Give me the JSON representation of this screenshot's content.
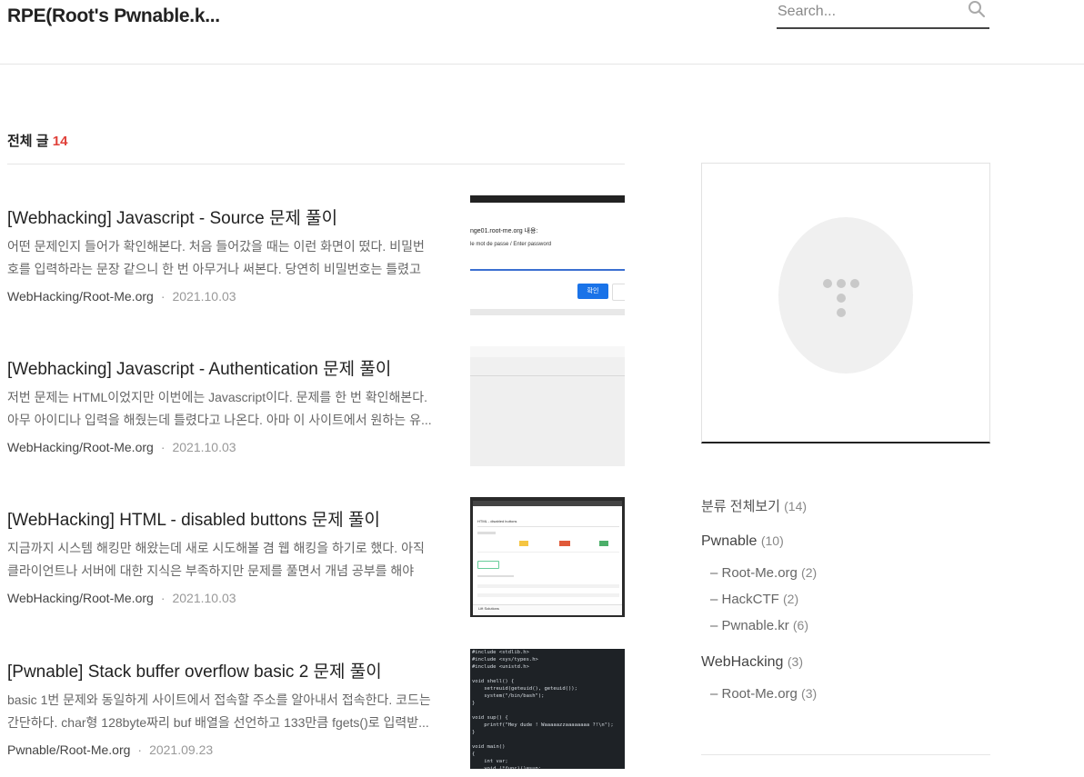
{
  "header": {
    "site_title": "RPE(Root's Pwnable.k...",
    "search_placeholder": "Search..."
  },
  "listing": {
    "label": "전체 글",
    "count": "14"
  },
  "posts": [
    {
      "title": "[Webhacking] Javascript - Source 문제 풀이",
      "excerpt": "어떤 문제인지 들어가 확인해본다. 처음 들어갔을 때는 이런 화면이 떴다. 비밀번호를 입력하라는 문장 같으니 한 번 아무거나 써본다. 당연히 비밀번호는 틀렸고 개...",
      "category": "WebHacking/Root-Me.org",
      "date": "2021.10.03",
      "thumb": {
        "dialog_title": "nge01.root-me.org 내용:",
        "dialog_prompt": "le mot de passe / Enter password",
        "ok_label": "확인"
      }
    },
    {
      "title": "[Webhacking] Javascript - Authentication 문제 풀이",
      "excerpt": "저번 문제는 HTML이었지만 이번에는 Javascript이다. 문제를 한 번 확인해본다. 아무 아이디나 입력을 해줬는데 틀렸다고 나온다. 아마 이 사이트에서 원하는 유...",
      "category": "WebHacking/Root-Me.org",
      "date": "2021.10.03"
    },
    {
      "title": "[WebHacking] HTML - disabled buttons 문제 풀이",
      "excerpt": "지금까지 시스템 해킹만 해왔는데 새로 시도해볼 겸 웹 해킹을 하기로 했다. 아직 클라이언트나 서버에 대한 지식은 부족하지만 문제를 풀면서 개념 공부를 해야겠...",
      "category": "WebHacking/Root-Me.org",
      "date": "2021.10.03",
      "thumb": {
        "page_title": "HTML - disabled buttons",
        "footer_text": "Lift Solutions"
      }
    },
    {
      "title": "[Pwnable] Stack buffer overflow basic 2 문제 풀이",
      "excerpt": "basic 1번 문제와 동일하게 사이트에서 접속할 주소를 알아내서 접속한다. 코드는 간단하다. char형 128byte짜리 buf 배열을 선언하고 133만큼 fgets()로 입력받...",
      "category": "Pwnable/Root-Me.org",
      "date": "2021.09.23",
      "thumb": {
        "code_lines": [
          "#include <stdlib.h>",
          "#include <sys/types.h>",
          "#include <unistd.h>",
          "",
          "void shell() {",
          "    setreuid(geteuid(), geteuid());",
          "    system(\"/bin/bash\");",
          "}",
          "",
          "void sup() {",
          "    printf(\"Hey dude ! Waaaaazzaaaaaaaa ?!\\n\");",
          "}",
          "",
          "void main()",
          "{",
          "    int var;",
          "    void (*func)()=sup;"
        ]
      }
    }
  ],
  "sidebar": {
    "categories": [
      {
        "label": "분류 전체보기",
        "count": "(14)"
      },
      {
        "label": "Pwnable",
        "count": "(10)"
      },
      {
        "label": "– Root-Me.org",
        "count": "(2)"
      },
      {
        "label": "– HackCTF",
        "count": "(2)"
      },
      {
        "label": "– Pwnable.kr",
        "count": "(6)"
      },
      {
        "label": "WebHacking",
        "count": "(3)"
      },
      {
        "label": "– Root-Me.org",
        "count": "(3)"
      }
    ]
  },
  "colors": {
    "accent_count": "#e0413a",
    "text_primary": "#222222",
    "text_muted": "#999999"
  }
}
